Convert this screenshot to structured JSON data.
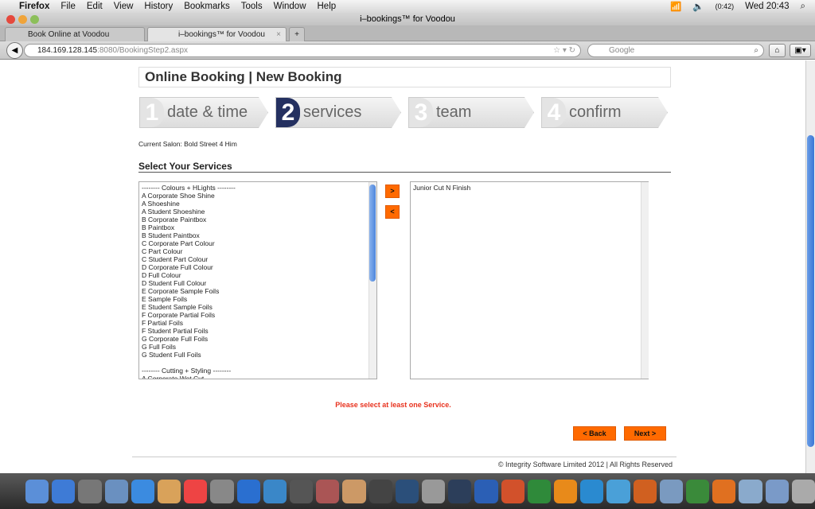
{
  "menubar": {
    "app": "Firefox",
    "items": [
      "File",
      "Edit",
      "View",
      "History",
      "Bookmarks",
      "Tools",
      "Window",
      "Help"
    ],
    "status": {
      "battery": "(0:42)",
      "clock": "Wed 20:43"
    }
  },
  "window": {
    "title": "i–bookings™ for Voodou"
  },
  "tabs": [
    {
      "label": "Book Online at Voodou Liverpo...",
      "active": false
    },
    {
      "label": "i–bookings™ for Voodou",
      "active": true
    }
  ],
  "nav": {
    "url_host": "184.169.128.145",
    "url_rest": ":8080/BookingStep2.aspx",
    "search_placeholder": "Google"
  },
  "page": {
    "title": "Online Booking | New Booking",
    "steps": [
      {
        "num": "1",
        "label": "date & time"
      },
      {
        "num": "2",
        "label": "services",
        "current": true
      },
      {
        "num": "3",
        "label": "team member"
      },
      {
        "num": "4",
        "label": "confirm"
      }
    ],
    "current_salon": "Current Salon: Bold Street 4 Him",
    "section_title": "Select Your Services",
    "available_services": [
      "-------- Colours + HLights --------",
      "A Corporate Shoe Shine",
      "A Shoeshine",
      "A Student Shoeshine",
      "B Corporate Paintbox",
      "B Paintbox",
      "B Student Paintbox",
      "C Corporate Part Colour",
      "C Part Colour",
      "C Student Part Colour",
      "D Corporate Full Colour",
      "D Full Colour",
      "D Student Full Colour",
      "E Corporate Sample Foils",
      "E Sample Foils",
      "E Student Sample Foils",
      "F Corporate Partial Foils",
      "F Partial Foils",
      "F Student Partial Foils",
      "G Corporate Full Foils",
      "G Full Foils",
      "G Student Full Foils",
      "",
      "-------- Cutting + Styling --------",
      "A Corporate Wet Cut"
    ],
    "selected_services": [
      "Junior Cut N Finish"
    ],
    "add_label": ">",
    "remove_label": "<",
    "error": "Please select at least one Service.",
    "back_label": "< Back",
    "next_label": "Next >",
    "footer": "© Integrity Software Limited 2012 | All Rights Reserved",
    "accent": "#ff6a00"
  },
  "dock": {
    "icons": [
      "finder",
      "app-store",
      "dashboard",
      "preview",
      "safari",
      "address-book",
      "ical",
      "photo-booth",
      "itunes",
      "iphoto",
      "imovie",
      "garageband",
      "keynote",
      "photo-booth-2",
      "time-machine",
      "system-preferences",
      "lightroom",
      "word",
      "powerpoint",
      "excel",
      "outlook",
      "communicator",
      "network",
      "keynote-2",
      "pages",
      "numbers",
      "firefox",
      "folder",
      "downloads",
      "trash"
    ]
  }
}
